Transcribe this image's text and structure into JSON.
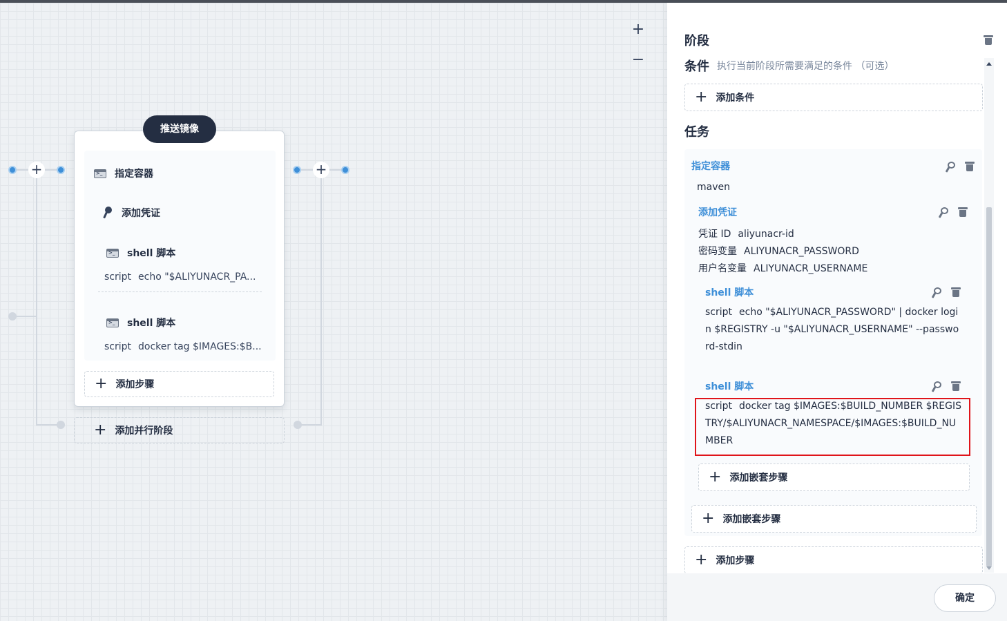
{
  "canvas": {
    "zoom_in": "+",
    "zoom_out": "−",
    "stage": {
      "title": "推送镜像",
      "steps": [
        {
          "name": "指定容器",
          "icon": "terminal-icon"
        },
        {
          "name": "添加凭证",
          "icon": "key-icon"
        },
        {
          "name": "shell 脚本",
          "icon": "terminal-icon",
          "key": "script",
          "value": "echo \"$ALIYUNACR_PA..."
        },
        {
          "name": "shell 脚本",
          "icon": "terminal-icon",
          "key": "script",
          "value": "docker tag $IMAGES:$B..."
        }
      ],
      "add_step": "添加步骤"
    },
    "add_parallel": "添加并行阶段",
    "plus": "+"
  },
  "panel": {
    "stage_heading": "阶段",
    "conditions": {
      "title": "条件",
      "hint": "执行当前阶段所需要满足的条件 （可选）",
      "add_label": "添加条件"
    },
    "tasks_heading": "任务",
    "container": {
      "title": "指定容器",
      "value": "maven"
    },
    "credential": {
      "title": "添加凭证",
      "fields": [
        {
          "key": "凭证 ID",
          "value": "aliyunacr-id"
        },
        {
          "key": "密码变量",
          "value": "ALIYUNACR_PASSWORD"
        },
        {
          "key": "用户名变量",
          "value": "ALIYUNACR_USERNAME"
        }
      ]
    },
    "shell_1": {
      "title": "shell 脚本",
      "key": "script",
      "value": "echo \"$ALIYUNACR_PASSWORD\" | docker login $REGISTRY -u \"$ALIYUNACR_USERNAME\" --password-stdin"
    },
    "shell_2": {
      "title": "shell 脚本",
      "key": "script",
      "value": "docker tag $IMAGES:$BUILD_NUMBER $REGISTRY/$ALIYUNACR_NAMESPACE/$IMAGES:$BUILD_NUMBER"
    },
    "add_nested_inner": "添加嵌套步骤",
    "add_nested_outer": "添加嵌套步骤",
    "add_step": "添加步骤",
    "plus": "+",
    "confirm": "确定"
  },
  "colors": {
    "accent": "#3e8fd8",
    "dark": "#242e42",
    "highlight": "#e0141a"
  }
}
